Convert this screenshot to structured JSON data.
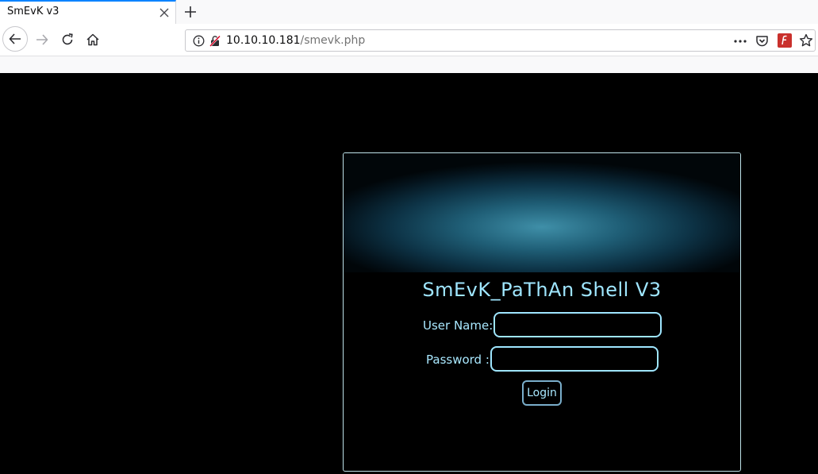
{
  "browser": {
    "tab": {
      "title": "SmEvK v3"
    },
    "url": {
      "host": "10.10.10.181",
      "path": "/smevk.php"
    },
    "icons": [
      "close-icon",
      "plus-icon",
      "back-arrow-icon",
      "forward-arrow-icon",
      "reload-icon",
      "home-icon",
      "info-icon",
      "insecure-lock-icon",
      "more-icon",
      "pocket-icon",
      "extension-icon",
      "star-icon"
    ]
  },
  "page": {
    "background": "#000000",
    "accent": "#9fe6ff",
    "title": "SmEvK_PaThAn Shell V3",
    "form": {
      "username_label": "User Name:",
      "username_value": "",
      "password_label": "Password :",
      "password_value": "",
      "submit_label": "Login"
    }
  }
}
